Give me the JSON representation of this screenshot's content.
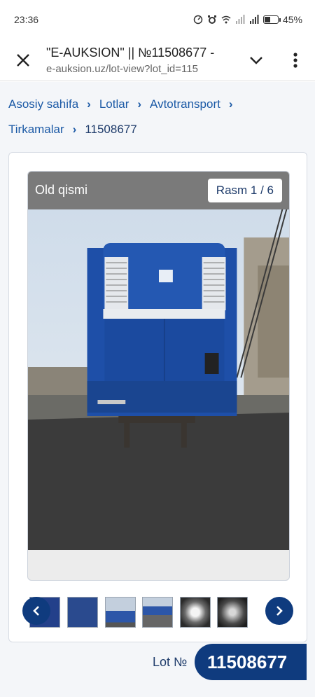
{
  "status_bar": {
    "time": "23:36",
    "battery": "45%",
    "icons": [
      "speed-icon",
      "alarm-icon",
      "wifi-icon",
      "signal-icon",
      "signal-icon",
      "battery-icon"
    ]
  },
  "browser": {
    "title": "\"E-AUKSION\" || №11508677 -",
    "address": "e-auksion.uz/lot-view?lot_id=115"
  },
  "breadcrumb": {
    "items": [
      "Asosiy sahifa",
      "Lotlar",
      "Avtotransport",
      "Tirkamalar"
    ],
    "current": "11508677"
  },
  "gallery": {
    "caption": "Old qismi",
    "counter": "Rasm 1 / 6",
    "thumbnail_count": 6
  },
  "lot": {
    "label": "Lot №",
    "number": "11508677"
  },
  "colors": {
    "accent": "#0f3b7e",
    "link": "#1c5aa6",
    "trailer_blue": "#1e4fa8"
  }
}
